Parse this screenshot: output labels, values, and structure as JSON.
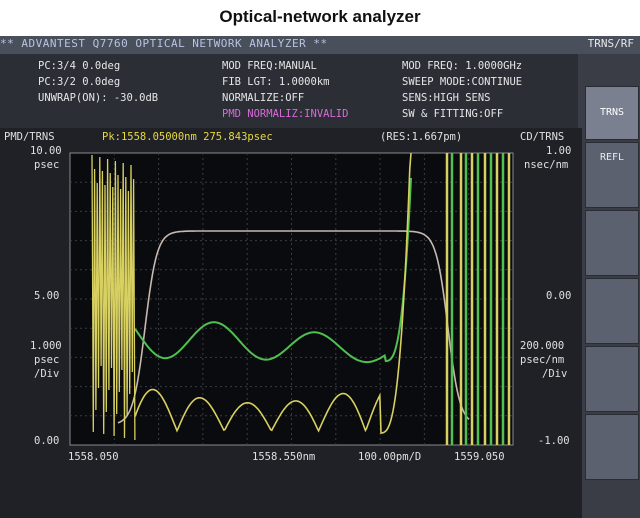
{
  "caption": "Optical-network analyzer",
  "title_bar": {
    "title": "** ADVANTEST Q7760 OPTICAL NETWORK ANALYZER **",
    "mode_label": "TRNS/RF"
  },
  "info_panel": {
    "pc_34": "PC:3/4     0.0deg",
    "pc_32": "PC:3/2     0.0deg",
    "unwrap": "UNWRAP(ON): -30.0dB",
    "mod_freq_mode": "MOD FREQ:MANUAL",
    "fib_lgt": "FIB LGT:   1.0000km",
    "normalize": "NORMALIZE:OFF",
    "pmd_normaliz": "PMD NORMALIZ:INVALID",
    "mod_freq": "MOD FREQ:   1.0000GHz",
    "sweep_mode": "SWEEP MODE:CONTINUE",
    "sens": "SENS:HIGH SENS",
    "sw_fitting": "SW & FITTING:OFF"
  },
  "chart_header": {
    "left_label": "PMD/TRNS",
    "peak": "Pk:1558.05000nm  275.843psec",
    "res": "(RES:1.667pm)",
    "right_label": "CD/TRNS"
  },
  "left_axis": {
    "top": "10.00",
    "top_unit": "psec",
    "mid": "5.00",
    "div_value": "1.000",
    "div_unit1": "psec",
    "div_unit2": "/Div",
    "bottom": "0.00"
  },
  "right_axis": {
    "top": "1.00",
    "top_unit": "nsec/nm",
    "mid": "0.00",
    "div_value": "200.000",
    "div_unit1": "psec/nm",
    "div_unit2": "/Div",
    "bottom": "-1.00"
  },
  "x_axis": {
    "start": "1558.050",
    "center": "1558.550nm",
    "span": "100.00pm/D",
    "stop": "1559.050"
  },
  "softkeys": [
    "TRNS",
    "REFL",
    "",
    "",
    "",
    ""
  ],
  "colors": {
    "peak_text": "#e8d840",
    "pmd_trace": "#d8d060",
    "cd_trace": "#50c050",
    "trns_trace": "#c8b8b0",
    "pink": "#d86ad8"
  }
}
